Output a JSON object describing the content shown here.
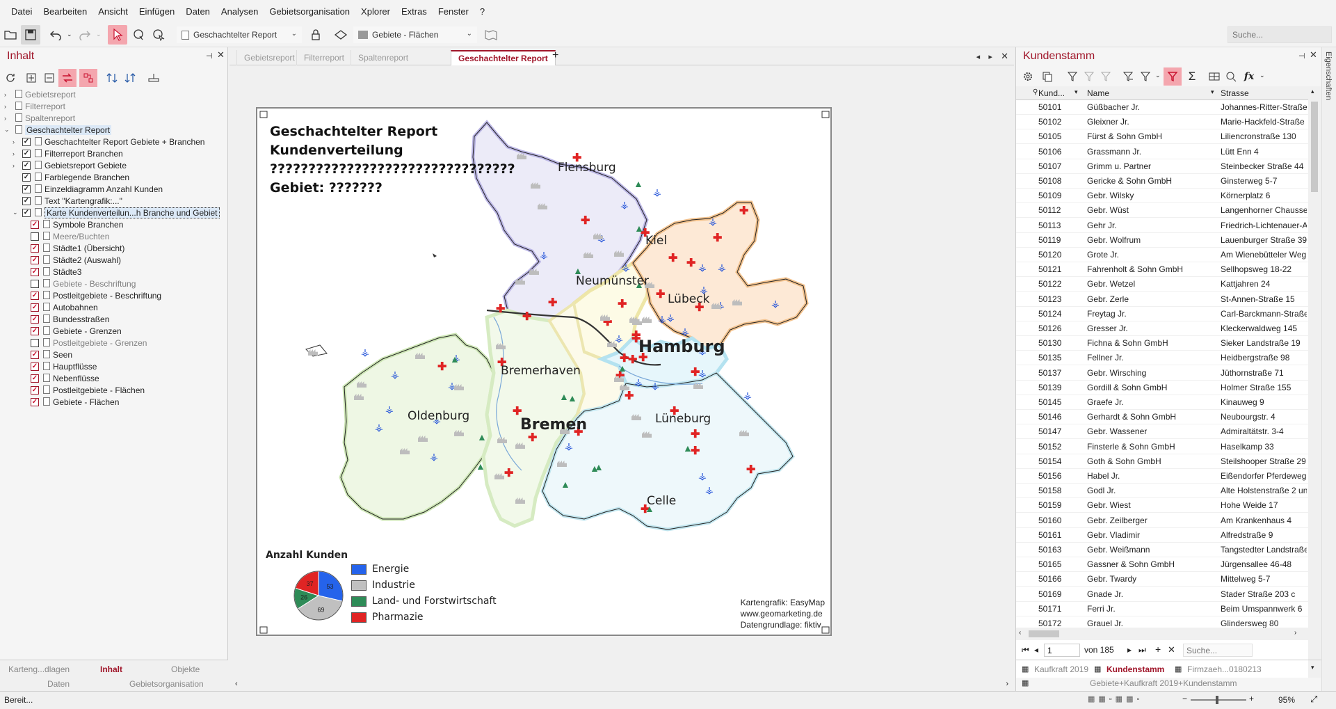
{
  "menu": [
    "Datei",
    "Bearbeiten",
    "Ansicht",
    "Einfügen",
    "Daten",
    "Analysen",
    "Gebietsorganisation",
    "Xplorer",
    "Extras",
    "Fenster",
    "?"
  ],
  "toolbar": {
    "report_combo": "Geschachtelter Report",
    "layer_combo": "Gebiete - Flächen",
    "search_placeholder": "Suche..."
  },
  "left_panel": {
    "title": "Inhalt",
    "tree": [
      {
        "label": "Gebietsreport",
        "level": 0,
        "expander": "›",
        "checkbox": "none",
        "grey": true
      },
      {
        "label": "Filterreport",
        "level": 0,
        "expander": "›",
        "checkbox": "none",
        "grey": true
      },
      {
        "label": "Spaltenreport",
        "level": 0,
        "expander": "›",
        "checkbox": "none",
        "grey": true
      },
      {
        "label": "Geschachtelter Report",
        "level": 0,
        "expander": "⌄",
        "checkbox": "none",
        "grey": false,
        "selected": true
      },
      {
        "label": "Geschachtelter Report Gebiete + Branchen",
        "level": 1,
        "expander": "›",
        "checkbox": "on"
      },
      {
        "label": "Filterreport Branchen",
        "level": 1,
        "expander": "›",
        "checkbox": "on"
      },
      {
        "label": "Gebietsreport Gebiete",
        "level": 1,
        "expander": "›",
        "checkbox": "on"
      },
      {
        "label": "Farblegende Branchen",
        "level": 1,
        "expander": "",
        "checkbox": "on"
      },
      {
        "label": "Einzeldiagramm Anzahl Kunden",
        "level": 1,
        "expander": "",
        "checkbox": "on"
      },
      {
        "label": "Text \"Kartengrafik:...\"",
        "level": 1,
        "expander": "",
        "checkbox": "on"
      },
      {
        "label": "Karte Kundenverteilun...h Branche und Gebiet",
        "level": 1,
        "expander": "⌄",
        "checkbox": "on",
        "focus": true
      },
      {
        "label": "Symbole Branchen",
        "level": 2,
        "checkbox": "red-on"
      },
      {
        "label": "Meere/Buchten",
        "level": 2,
        "checkbox": "off",
        "grey": true
      },
      {
        "label": "Städte1 (Übersicht)",
        "level": 2,
        "checkbox": "red-on"
      },
      {
        "label": "Städte2 (Auswahl)",
        "level": 2,
        "checkbox": "red-on"
      },
      {
        "label": "Städte3",
        "level": 2,
        "checkbox": "red-on"
      },
      {
        "label": "Gebiete - Beschriftung",
        "level": 2,
        "checkbox": "off",
        "grey": true
      },
      {
        "label": "Postleitgebiete - Beschriftung",
        "level": 2,
        "checkbox": "red-on"
      },
      {
        "label": "Autobahnen",
        "level": 2,
        "checkbox": "red-on"
      },
      {
        "label": "Bundesstraßen",
        "level": 2,
        "checkbox": "red-on"
      },
      {
        "label": "Gebiete - Grenzen",
        "level": 2,
        "checkbox": "red-on"
      },
      {
        "label": "Postleitgebiete - Grenzen",
        "level": 2,
        "checkbox": "off",
        "grey": true
      },
      {
        "label": "Seen",
        "level": 2,
        "checkbox": "red-on"
      },
      {
        "label": "Hauptflüsse",
        "level": 2,
        "checkbox": "red-on"
      },
      {
        "label": "Nebenflüsse",
        "level": 2,
        "checkbox": "red-on"
      },
      {
        "label": "Postleitgebiete - Flächen",
        "level": 2,
        "checkbox": "red-on"
      },
      {
        "label": "Gebiete - Flächen",
        "level": 2,
        "checkbox": "red-on"
      }
    ],
    "bottom_tabs": [
      "Karteng...dlagen",
      "Inhalt",
      "Objekte"
    ],
    "bottom_tabs2": [
      "Daten",
      "Gebietsorganisation"
    ]
  },
  "doc_tabs": [
    "Gebietsreport",
    "Filterreport",
    "Spaltenreport",
    "Geschachtelter Report"
  ],
  "report": {
    "title_lines": [
      "Geschachtelter Report",
      "Kundenverteilung",
      "????????????????????????????????",
      "Gebiet: ???????"
    ],
    "cities": [
      {
        "name": "Flensburg",
        "size": "normal"
      },
      {
        "name": "Kiel",
        "size": "normal"
      },
      {
        "name": "Neumünster",
        "size": "normal"
      },
      {
        "name": "Lübeck",
        "size": "normal"
      },
      {
        "name": "Hamburg",
        "size": "big"
      },
      {
        "name": "Bremerhaven",
        "size": "normal"
      },
      {
        "name": "Oldenburg",
        "size": "normal"
      },
      {
        "name": "Bremen",
        "size": "big"
      },
      {
        "name": "Lüneburg",
        "size": "normal"
      },
      {
        "name": "Celle",
        "size": "normal"
      }
    ],
    "pie_title": "Anzahl Kunden",
    "pie": [
      {
        "label": "Energie",
        "value": 53,
        "color": "#2563eb"
      },
      {
        "label": "Industrie",
        "value": 69,
        "color": "#c0c0c0"
      },
      {
        "label": "Land- und Forstwirtschaft",
        "value": 26,
        "color": "#2e8b57"
      },
      {
        "label": "Pharmazie",
        "value": 37,
        "color": "#e02424"
      }
    ],
    "credit": [
      "Kartengrafik: EasyMap",
      "www.geomarketing.de",
      "Datengrundlage: fiktiv"
    ]
  },
  "right_panel": {
    "title": "Kundenstamm",
    "columns": [
      "Kund...",
      "Name",
      "Strasse"
    ],
    "rows": [
      [
        "50101",
        "Güßbacher Jr.",
        "Johannes-Ritter-Straße"
      ],
      [
        "50102",
        "Gleixner Jr.",
        "Marie-Hackfeld-Straße"
      ],
      [
        "50105",
        "Fürst & Sohn GmbH",
        "Liliencronstraße 130"
      ],
      [
        "50106",
        "Grassmann Jr.",
        "Lütt Enn 4"
      ],
      [
        "50107",
        "Grimm u. Partner",
        "Steinbecker Straße 44"
      ],
      [
        "50108",
        "Gericke & Sohn GmbH",
        "Ginsterweg 5-7"
      ],
      [
        "50109",
        "Gebr. Wilsky",
        "Körnerplatz 6"
      ],
      [
        "50112",
        "Gebr. Wüst",
        "Langenhorner Chaussee"
      ],
      [
        "50113",
        "Gehr Jr.",
        "Friedrich-Lichtenauer-A"
      ],
      [
        "50119",
        "Gebr. Wolfrum",
        "Lauenburger Straße 39"
      ],
      [
        "50120",
        "Grote Jr.",
        "Am Wienebütteler Weg"
      ],
      [
        "50121",
        "Fahrenholt & Sohn GmbH",
        "Sellhopsweg 18-22"
      ],
      [
        "50122",
        "Gebr. Wetzel",
        "Kattjahren 24"
      ],
      [
        "50123",
        "Gebr. Zerle",
        "St-Annen-Straße 15"
      ],
      [
        "50124",
        "Freytag Jr.",
        "Carl-Barckmann-Straße"
      ],
      [
        "50126",
        "Gresser Jr.",
        "Kleckerwaldweg 145"
      ],
      [
        "50130",
        "Fichna & Sohn GmbH",
        "Sieker Landstraße 19"
      ],
      [
        "50135",
        "Fellner Jr.",
        "Heidbergstraße 98"
      ],
      [
        "50137",
        "Gebr. Wirsching",
        "Jüthornstraße 71"
      ],
      [
        "50139",
        "Gordill & Sohn GmbH",
        "Holmer Straße 155"
      ],
      [
        "50145",
        "Graefe Jr.",
        "Kinauweg 9"
      ],
      [
        "50146",
        "Gerhardt & Sohn GmbH",
        "Neubourgstr. 4"
      ],
      [
        "50147",
        "Gebr. Wassener",
        "Admiraltätstr. 3-4"
      ],
      [
        "50152",
        "Finsterle & Sohn GmbH",
        "Haselkamp 33"
      ],
      [
        "50154",
        "Goth & Sohn GmbH",
        "Steilshooper Straße 29"
      ],
      [
        "50156",
        "Habel Jr.",
        "Eißendorfer Pferdeweg"
      ],
      [
        "50158",
        "Godl Jr.",
        "Alte Holstenstraße 2 un"
      ],
      [
        "50159",
        "Gebr. Wiest",
        "Hohe Weide 17"
      ],
      [
        "50160",
        "Gebr. Zeilberger",
        "Am Krankenhaus 4"
      ],
      [
        "50161",
        "Gebr. Vladimir",
        "Alfredstraße 9"
      ],
      [
        "50163",
        "Gebr. Weißmann",
        "Tangstedter Landstraße"
      ],
      [
        "50165",
        "Gassner & Sohn GmbH",
        "Jürgensallee 46-48"
      ],
      [
        "50166",
        "Gebr. Twardy",
        "Mittelweg 5-7"
      ],
      [
        "50169",
        "Gnade Jr.",
        "Stader Straße 203 c"
      ],
      [
        "50171",
        "Ferri Jr.",
        "Beim Umspannwerk 6"
      ],
      [
        "50172",
        "Grauel Jr.",
        "Glindersweg 80"
      ]
    ],
    "pager_value": "1",
    "pager_of": "von 185",
    "search_placeholder": "Suche...",
    "bottom_tabs": [
      "Kaufkraft 2019",
      "Kundenstamm",
      "Firmzaeh...0180213"
    ],
    "bottom_caption": "Gebiete+Kaufkraft 2019+Kundenstamm"
  },
  "side_strip": "Eigenschaften",
  "status": {
    "text": "Bereit...",
    "zoom": "95%"
  }
}
